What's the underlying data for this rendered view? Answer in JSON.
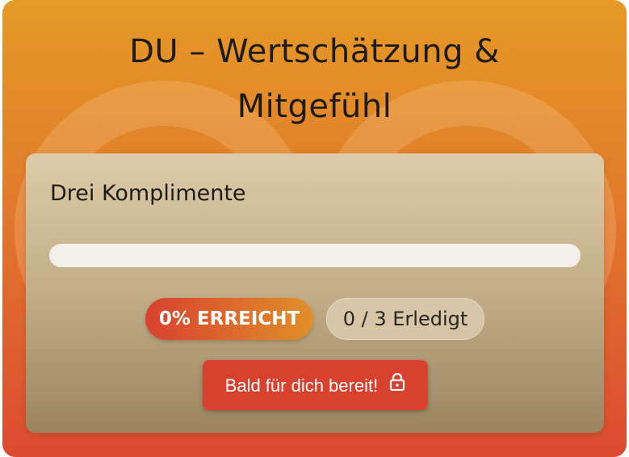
{
  "header": {
    "title_line1": "DU – Wertschätzung &",
    "title_line2": "Mitgefühl"
  },
  "task": {
    "title": "Drei Komplimente",
    "progress_percent": 0,
    "percent_label": "0% ERREICHT",
    "count_label": "0 / 3 Erledigt",
    "button_label": "Bald für dich bereit!",
    "button_icon": "lock-icon"
  },
  "colors": {
    "accent_red": "#d9412f",
    "accent_orange": "#e59a26",
    "track": "#f3f0ec"
  }
}
